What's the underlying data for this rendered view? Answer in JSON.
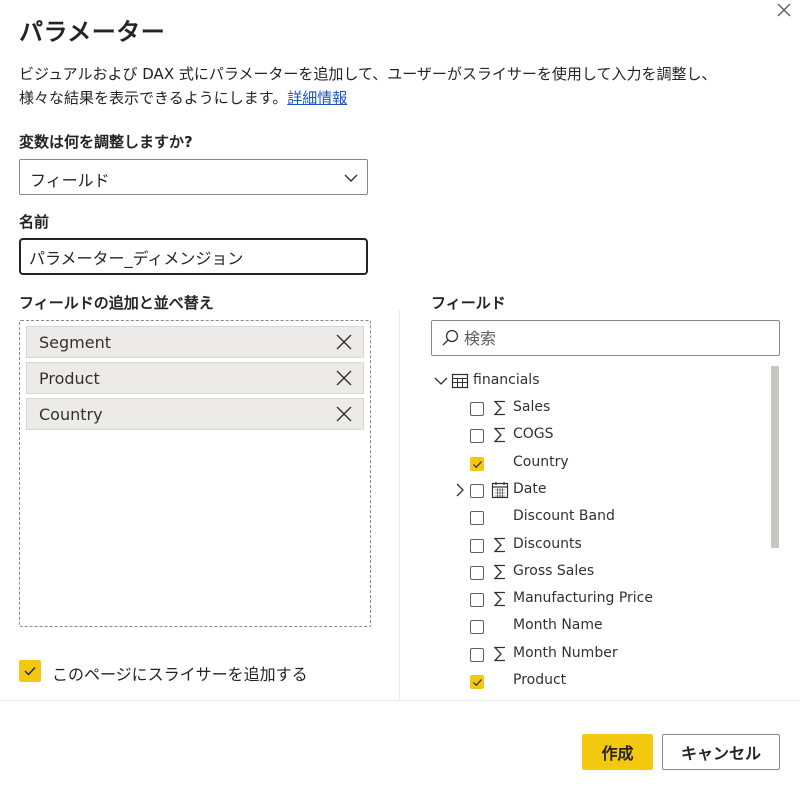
{
  "dialog": {
    "title": "パラメーター",
    "description_line1": "ビジュアルおよび DAX 式にパラメーターを追加して、ユーザーがスライサーを使用して入力を調整し、",
    "description_line2": "様々な結果を表示できるようにします。",
    "learn_more_link": "詳細情報"
  },
  "adjust": {
    "label": "変数は何を調整しますか?",
    "selected": "フィールド"
  },
  "name": {
    "label": "名前",
    "value": "パラメーター_ディメンジョン"
  },
  "fields_list": {
    "label": "フィールドの追加と並べ替え",
    "items": [
      "Segment",
      "Product",
      "Country"
    ]
  },
  "field_picker": {
    "label": "フィールド",
    "search_placeholder": "検索",
    "table_name": "financials",
    "rows": [
      {
        "label": "Sales",
        "icon": "sigma-icon",
        "checked": false
      },
      {
        "label": "COGS",
        "icon": "sigma-icon",
        "checked": false
      },
      {
        "label": "Country",
        "icon": "",
        "checked": true
      },
      {
        "label": "Date",
        "icon": "calendar-icon",
        "checked": false,
        "expandable": true
      },
      {
        "label": "Discount Band",
        "icon": "",
        "checked": false
      },
      {
        "label": "Discounts",
        "icon": "sigma-icon",
        "checked": false
      },
      {
        "label": "Gross Sales",
        "icon": "sigma-icon",
        "checked": false
      },
      {
        "label": "Manufacturing Price",
        "icon": "sigma-icon",
        "checked": false
      },
      {
        "label": "Month Name",
        "icon": "",
        "checked": false
      },
      {
        "label": "Month Number",
        "icon": "sigma-icon",
        "checked": false
      },
      {
        "label": "Product",
        "icon": "",
        "checked": true
      }
    ]
  },
  "add_slicer": {
    "label": "このページにスライサーを追加する",
    "checked": true
  },
  "buttons": {
    "create": "作成",
    "cancel": "キャンセル"
  },
  "colors": {
    "accent": "#f2c811",
    "link": "#1a56c4",
    "text": "#252423"
  }
}
